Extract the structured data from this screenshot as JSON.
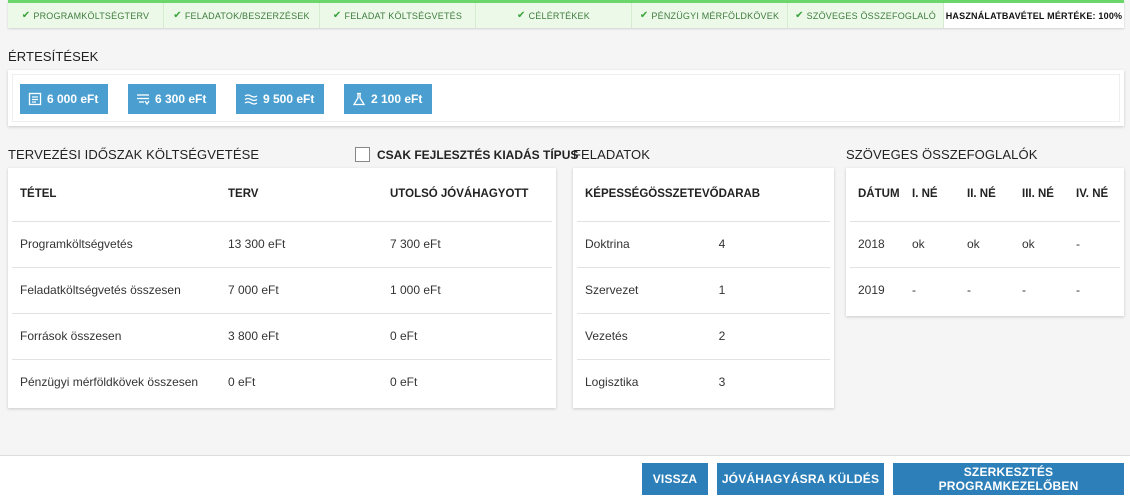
{
  "steps": [
    {
      "label": "PROGRAMKÖLTSÉGTERV"
    },
    {
      "label": "FELADATOK/BESZERZÉSEK"
    },
    {
      "label": "FELADAT KÖLTSÉGVETÉS"
    },
    {
      "label": "CÉLÉRTÉKEK"
    },
    {
      "label": "PÉNZÜGYI MÉRFÖLDKÖVEK"
    },
    {
      "label": "SZÖVEGES ÖSSZEFOGLALÓ"
    }
  ],
  "usage_label": "HASZNÁLATBAVÉTEL MÉRTÉKE: 100%",
  "notifications": {
    "title": "ÉRTESÍTÉSEK",
    "buttons": [
      {
        "label": "6 000 eFt",
        "icon": "document-list-icon"
      },
      {
        "label": "6 300 eFt",
        "icon": "filter-list-icon"
      },
      {
        "label": "9 500 eFt",
        "icon": "waves-icon"
      },
      {
        "label": "2 100 eFt",
        "icon": "flask-icon"
      }
    ]
  },
  "budget": {
    "title": "TERVEZÉSI IDŐSZAK KÖLTSÉGVETÉSE",
    "checkbox_label": "CSAK FEJLESZTÉS KIADÁS TÍPUS",
    "headers": [
      "TÉTEL",
      "TERV",
      "UTOLSÓ JÓVÁHAGYOTT"
    ],
    "rows": [
      [
        "Programköltségvetés",
        "13 300 eFt",
        "7 300 eFt"
      ],
      [
        "Feladatköltségvetés összesen",
        "7 000 eFt",
        "1 000 eFt"
      ],
      [
        "Források összesen",
        "3 800 eFt",
        "0 eFt"
      ],
      [
        "Pénzügyi mérföldkövek összesen",
        "0 eFt",
        "0 eFt"
      ]
    ]
  },
  "tasks": {
    "title": "FELADATOK",
    "headers": [
      "KÉPESSÉGÖSSZETEVŐ",
      "DARAB"
    ],
    "rows": [
      [
        "Doktrina",
        "4"
      ],
      [
        "Szervezet",
        "1"
      ],
      [
        "Vezetés",
        "2"
      ],
      [
        "Logisztika",
        "3"
      ]
    ]
  },
  "summaries": {
    "title": "SZÖVEGES ÖSSZEFOGLALÓK",
    "headers": [
      "DÁTUM",
      "I. NÉ",
      "II. NÉ",
      "III. NÉ",
      "IV. NÉ"
    ],
    "rows": [
      [
        "2018",
        "ok",
        "ok",
        "ok",
        "-"
      ],
      [
        "2019",
        "-",
        "-",
        "-",
        "-"
      ]
    ]
  },
  "footer": {
    "back": "VISSZA",
    "submit": "JÓVÁHAGYÁSRA KÜLDÉS",
    "edit": "SZERKESZTÉS PROGRAMKEZELŐBEN"
  },
  "colors": {
    "accent": "#4a9fd0",
    "primary_button": "#2c7fb8",
    "step_done": "#6bd66b"
  }
}
